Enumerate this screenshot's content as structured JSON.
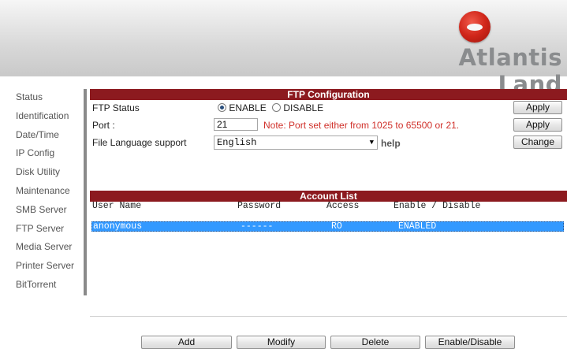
{
  "brand": {
    "name": "Atlantis Land",
    "logo_icon": "atlantis-logo-icon"
  },
  "sidebar": {
    "items": [
      {
        "label": "Status"
      },
      {
        "label": "Identification"
      },
      {
        "label": "Date/Time"
      },
      {
        "label": "IP Config"
      },
      {
        "label": "Disk Utility"
      },
      {
        "label": "Maintenance"
      },
      {
        "label": "SMB Server"
      },
      {
        "label": "FTP Server"
      },
      {
        "label": "Media Server"
      },
      {
        "label": "Printer Server"
      },
      {
        "label": "BitTorrent"
      }
    ]
  },
  "ftp_config": {
    "title": "FTP Configuration",
    "status_label": "FTP Status",
    "enable_label": "ENABLE",
    "disable_label": "DISABLE",
    "status_selected": "ENABLE",
    "port_label": "Port :",
    "port_value": "21",
    "port_note": "Note: Port set either from 1025 to 65500 or 21.",
    "language_label": "File Language support",
    "language_value": "English",
    "help_label": "help",
    "apply_label_1": "Apply",
    "apply_label_2": "Apply",
    "change_label": "Change"
  },
  "account_list": {
    "title": "Account List",
    "columns": [
      "User Name",
      "Password",
      "Access",
      "Enable / Disable"
    ],
    "rows": [
      {
        "user": "anonymous",
        "password": "------",
        "access": "RO",
        "status": "ENABLED",
        "selected": true
      }
    ]
  },
  "actions": {
    "add": "Add",
    "modify": "Modify",
    "delete": "Delete",
    "enable_disable": "Enable/Disable"
  },
  "colors": {
    "header_bar": "#8c1a1f",
    "selection": "#3399ff",
    "note": "#d0302a"
  }
}
